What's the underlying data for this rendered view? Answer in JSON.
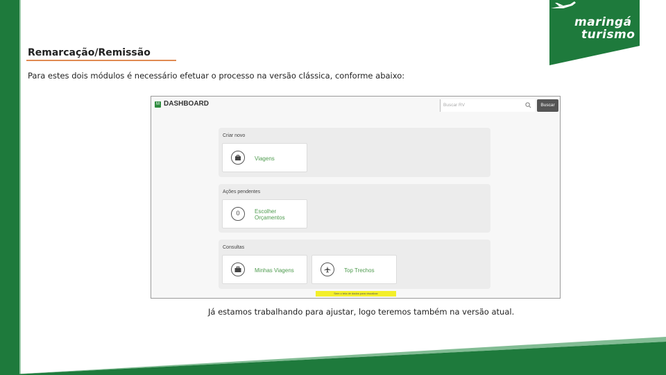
{
  "slide": {
    "heading": "Remarcação/Remissão",
    "intro": "Para estes dois módulos é necessário efetuar o processo na versão clássica, conforme abaixo:",
    "footer": "Já estamos trabalhando para ajustar, logo teremos também na versão atual."
  },
  "logo": {
    "line1": "maringá",
    "line2": "turismo",
    "color": "#1e7a3c"
  },
  "dashboard": {
    "title": "DASHBOARD",
    "logo_glyph": "M",
    "search_placeholder": "Buscar RV",
    "search_button": "Buscar",
    "sections": [
      {
        "title": "Criar novo",
        "cards": [
          {
            "label": "Viagens",
            "icon": "suitcase-icon"
          }
        ]
      },
      {
        "title": "Ações pendentes",
        "cards": [
          {
            "label_line1": "Escolher",
            "label_line2": "Orçamentos",
            "icon": "number-zero-icon",
            "count": "0"
          }
        ]
      },
      {
        "title": "Consultas",
        "cards": [
          {
            "label": "Minhas Viagens",
            "icon": "briefcase-icon"
          },
          {
            "label": "Top Trechos",
            "icon": "airplane-icon"
          }
        ]
      }
    ],
    "note": "Sem o tela de dados para visualizar"
  },
  "colors": {
    "accent_green": "#4e9b4e",
    "highlight": "#f3ef2a",
    "heading_underline": "#e08a52"
  }
}
